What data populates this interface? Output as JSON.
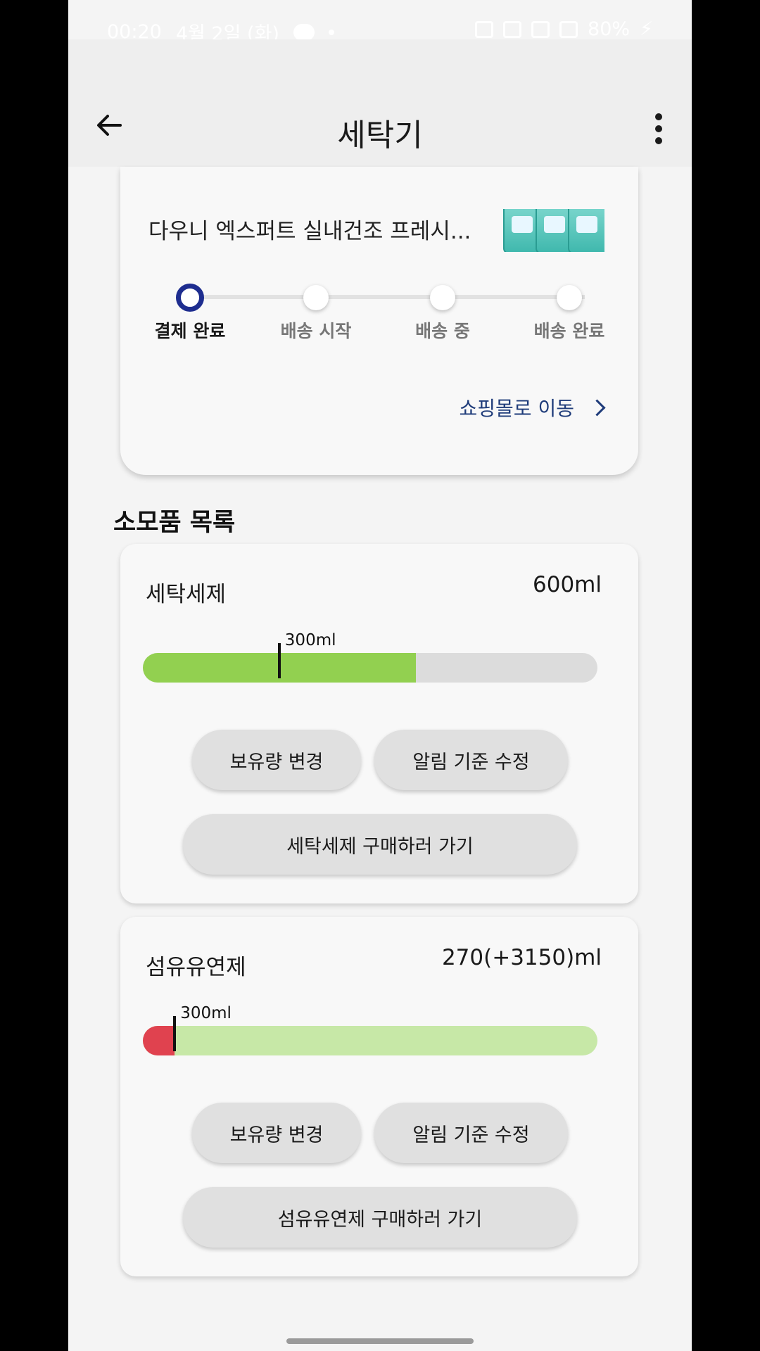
{
  "status_bar": {
    "time": "00:20",
    "date": "4월 2일 (화)",
    "battery": "80%"
  },
  "app_bar": {
    "title": "세탁기",
    "back_icon": "arrow-left-icon",
    "more_icon": "more-vertical-icon"
  },
  "order": {
    "product_name": "다우니 엑스퍼트 실내건조 프레시...",
    "steps": [
      {
        "label": "결제 완료",
        "active": true
      },
      {
        "label": "배송 시작",
        "active": false
      },
      {
        "label": "배송 중",
        "active": false
      },
      {
        "label": "배송 완료",
        "active": false
      }
    ],
    "shop_link": "쇼핑몰로 이동"
  },
  "section_title": "소모품 목록",
  "consumables": [
    {
      "name": "세탁세제",
      "amount": "600ml",
      "marker_label": "300ml",
      "level_fraction": 0.6,
      "marker_fraction": 0.3,
      "fill_color": "#92d050",
      "track_color": "#dcdcdc",
      "buttons": {
        "change": "보유량 변경",
        "alert": "알림 기준 수정",
        "buy": "세탁세제 구매하러 가기"
      }
    },
    {
      "name": "섬유유연제",
      "amount": "270(+3150)ml",
      "marker_label": "300ml",
      "level_fraction": 0.07,
      "marker_fraction": 0.07,
      "fill_color": "#e0424f",
      "track_color": "#c7e8a7",
      "buttons": {
        "change": "보유량 변경",
        "alert": "알림 기준 수정",
        "buy": "섬유유연제 구매하러 가기"
      }
    }
  ]
}
